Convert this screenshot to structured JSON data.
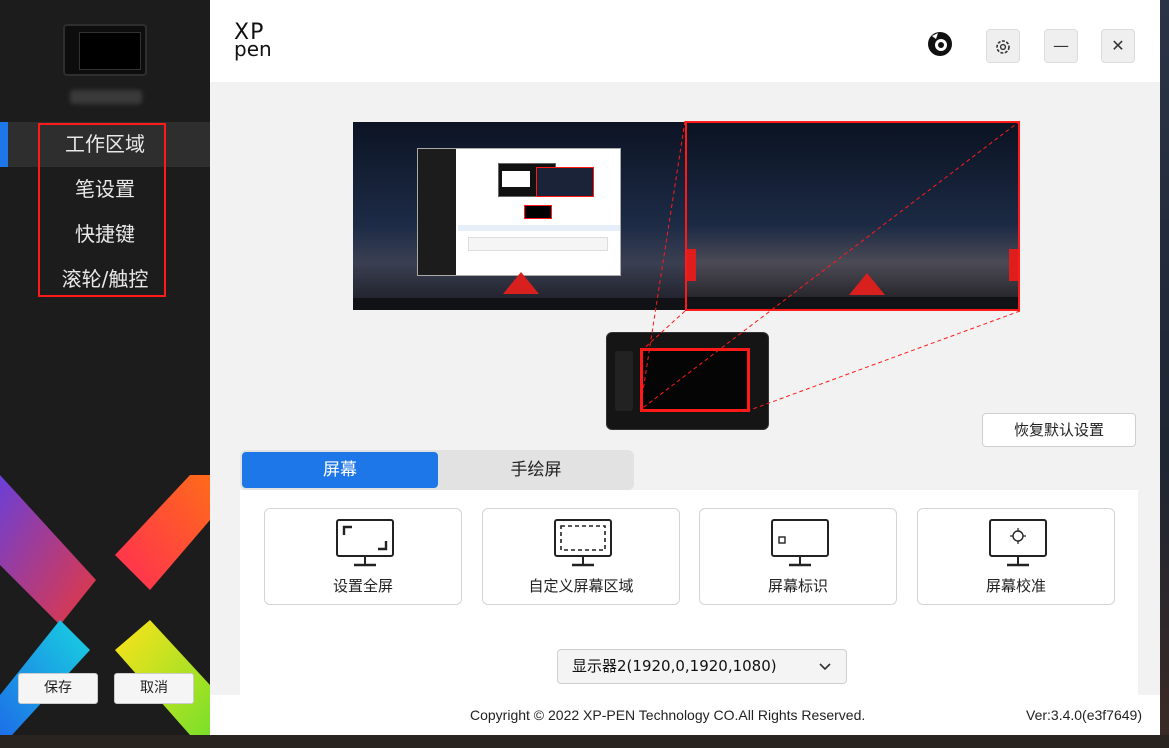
{
  "sidebar": {
    "nav": [
      {
        "label": "工作区域",
        "active": true
      },
      {
        "label": "笔设置",
        "active": false
      },
      {
        "label": "快捷键",
        "active": false
      },
      {
        "label": "滚轮/触控",
        "active": false
      }
    ],
    "save_label": "保存",
    "cancel_label": "取消",
    "accent": "#1e77e8",
    "highlight_color": "#ff1a1a"
  },
  "titlebar": {
    "brand_line1": "XP",
    "brand_line2": "pen",
    "icons": [
      "feedback-icon",
      "settings-gear-icon",
      "minimize-icon",
      "close-icon"
    ],
    "minimize_glyph": "—",
    "close_glyph": "✕"
  },
  "workarea": {
    "restore_label": "恢复默认设置",
    "tabs": [
      {
        "label": "屏幕",
        "active": true
      },
      {
        "label": "手绘屏",
        "active": false
      }
    ],
    "cards": [
      {
        "label": "设置全屏",
        "icon": "fullscreen-monitor-icon"
      },
      {
        "label": "自定义屏幕区域",
        "icon": "custom-area-monitor-icon"
      },
      {
        "label": "屏幕标识",
        "icon": "identify-monitor-icon"
      },
      {
        "label": "屏幕校准",
        "icon": "calibrate-monitor-icon"
      }
    ],
    "display_select": "显示器2(1920,0,1920,1080)"
  },
  "footer": {
    "copyright": "Copyright © 2022  XP-PEN Technology CO.All Rights Reserved.",
    "version": "Ver:3.4.0(e3f7649)"
  }
}
